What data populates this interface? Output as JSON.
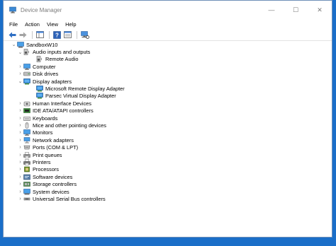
{
  "window": {
    "title": "Device Manager"
  },
  "caption": {
    "minimize": "—",
    "maximize": "☐",
    "close": "✕"
  },
  "menu": [
    "File",
    "Action",
    "View",
    "Help"
  ],
  "tree": {
    "root": "SandboxW10",
    "categories": [
      {
        "label": "Audio inputs and outputs",
        "expanded": true,
        "icon": "speaker-icon",
        "children": [
          {
            "label": "Remote Audio",
            "icon": "speaker-icon"
          }
        ]
      },
      {
        "label": "Computer",
        "icon": "monitor-icon"
      },
      {
        "label": "Disk drives",
        "icon": "disk-icon"
      },
      {
        "label": "Display adapters",
        "expanded": true,
        "icon": "display-adapter-icon",
        "children": [
          {
            "label": "Microsoft Remote Display Adapter",
            "icon": "display-adapter-icon"
          },
          {
            "label": "Parsec Virtual Display Adapter",
            "icon": "display-adapter-icon"
          }
        ]
      },
      {
        "label": "Human Interface Devices",
        "icon": "hid-icon"
      },
      {
        "label": "IDE ATA/ATAPI controllers",
        "icon": "ide-icon"
      },
      {
        "label": "Keyboards",
        "icon": "keyboard-icon"
      },
      {
        "label": "Mice and other pointing devices",
        "icon": "mouse-icon"
      },
      {
        "label": "Monitors",
        "icon": "monitor-icon"
      },
      {
        "label": "Network adapters",
        "icon": "network-icon"
      },
      {
        "label": "Ports (COM & LPT)",
        "icon": "port-icon"
      },
      {
        "label": "Print queues",
        "icon": "print-queue-icon"
      },
      {
        "label": "Printers",
        "icon": "printer-icon"
      },
      {
        "label": "Processors",
        "icon": "processor-icon"
      },
      {
        "label": "Software devices",
        "icon": "software-device-icon"
      },
      {
        "label": "Storage controllers",
        "icon": "storage-icon"
      },
      {
        "label": "System devices",
        "icon": "system-device-icon"
      },
      {
        "label": "Universal Serial Bus controllers",
        "icon": "usb-icon"
      }
    ]
  }
}
